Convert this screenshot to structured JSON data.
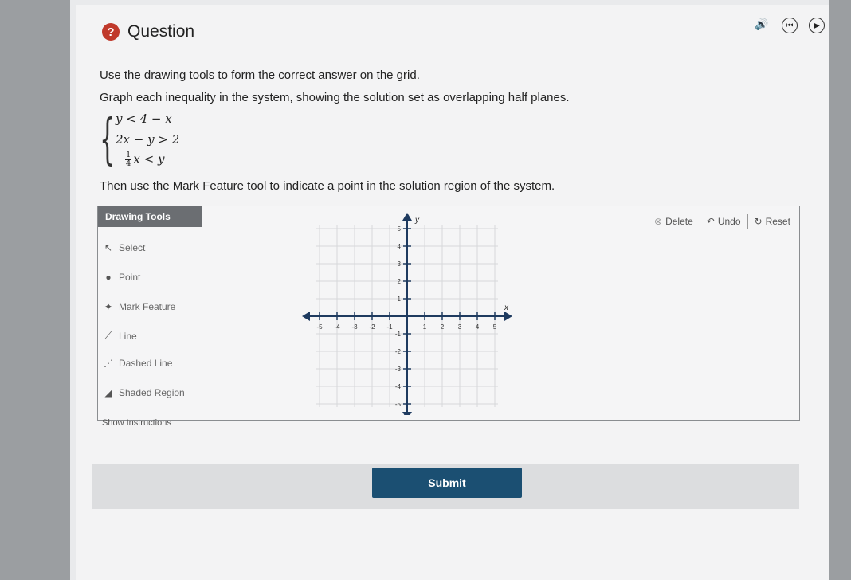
{
  "header": {
    "badge": "?",
    "title": "Question"
  },
  "header_icons": [
    "speaker-icon",
    "restart-icon",
    "play-icon"
  ],
  "instructions": {
    "line1": "Use the drawing tools to form the correct answer on the grid.",
    "line2": "Graph each inequality in the system, showing the solution set as overlapping half planes.",
    "line3": "Then use the Mark Feature tool to indicate a point in the solution region of the system."
  },
  "system": {
    "eq1": "y < 4 − x",
    "eq2": "2x − y > 2",
    "eq3_num": "1",
    "eq3_den": "4",
    "eq3_rest": "x < y"
  },
  "tools": {
    "heading": "Drawing Tools",
    "items": [
      {
        "label": "Select",
        "icon": "select-icon"
      },
      {
        "label": "Point",
        "icon": "point-icon"
      },
      {
        "label": "Mark Feature",
        "icon": "mark-feature-icon"
      },
      {
        "label": "Line",
        "icon": "line-icon"
      },
      {
        "label": "Dashed Line",
        "icon": "dashed-line-icon"
      },
      {
        "label": "Shaded Region",
        "icon": "shaded-region-icon"
      }
    ]
  },
  "actions": {
    "delete": "Delete",
    "undo": "Undo",
    "reset": "Reset"
  },
  "graph": {
    "x_label": "x",
    "y_label": "y",
    "x_ticks": [
      "-5",
      "-4",
      "-3",
      "-2",
      "-1",
      "1",
      "2",
      "3",
      "4",
      "5"
    ],
    "y_ticks": [
      "5",
      "4",
      "3",
      "2",
      "1",
      "-1",
      "-2",
      "-3",
      "-4",
      "-5"
    ]
  },
  "show_instructions": "Show Instructions",
  "submit": "Submit",
  "colors": {
    "badge": "#c0392b",
    "submit": "#1b4f72",
    "tools_header": "#6b6e72"
  }
}
